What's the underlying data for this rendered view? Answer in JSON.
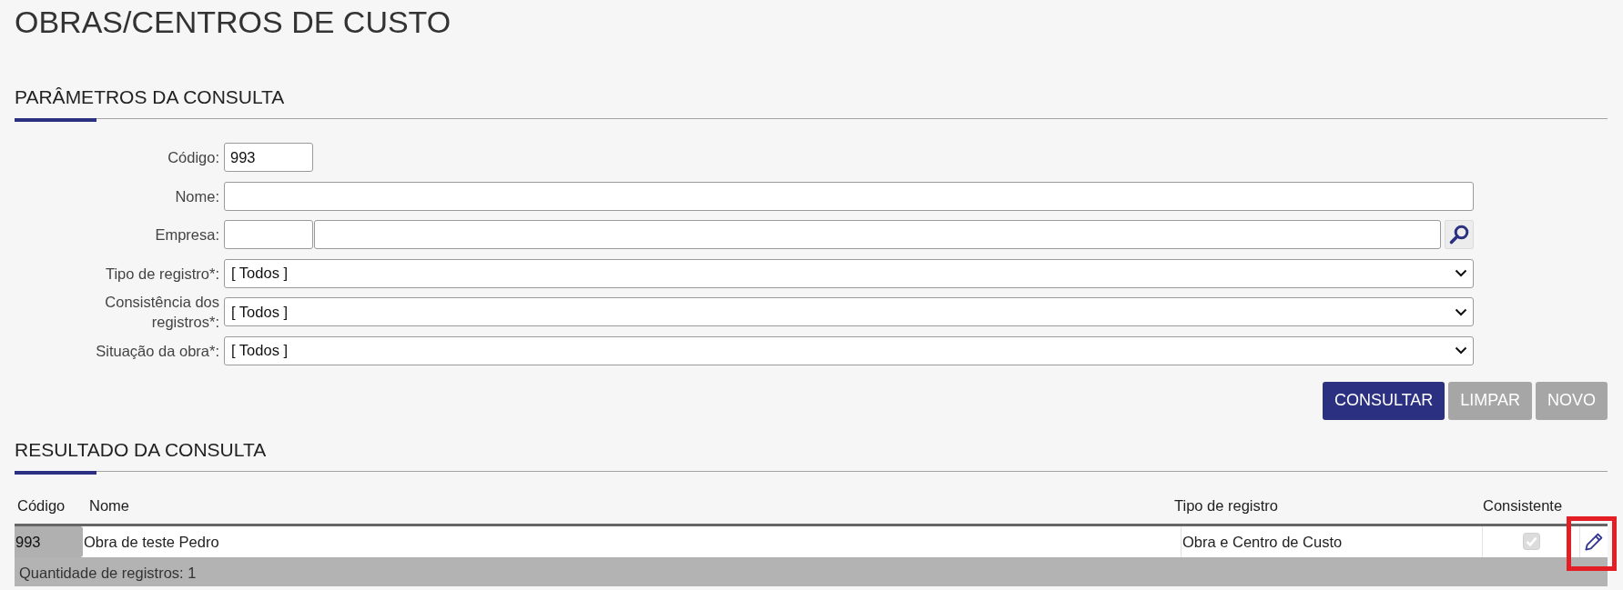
{
  "page": {
    "title": "OBRAS/CENTROS DE CUSTO"
  },
  "query": {
    "heading": "PARÂMETROS DA CONSULTA",
    "fields": [
      {
        "kind": "code",
        "label": "Código:",
        "value": "993"
      },
      {
        "kind": "text",
        "label": "Nome:"
      },
      {
        "kind": "lookup",
        "label": "Empresa:"
      },
      {
        "kind": "select",
        "label": "Tipo de registro*:",
        "value": "[ Todos ]"
      },
      {
        "kind": "select",
        "label": "Consistência dos registros*:",
        "value": "[ Todos ]"
      },
      {
        "kind": "select",
        "label": "Situação da obra*:",
        "value": "[ Todos ]"
      }
    ],
    "buttons": [
      {
        "label": "CONSULTAR",
        "kind": "primary"
      },
      {
        "label": "LIMPAR",
        "kind": "secondary"
      },
      {
        "label": "NOVO",
        "kind": "secondary"
      }
    ]
  },
  "results": {
    "heading": "RESULTADO DA CONSULTA",
    "table": {
      "columns": [
        "Código",
        "Nome",
        "Tipo de registro",
        "Consistente"
      ],
      "rows": [
        {
          "cells": [
            "993",
            "Obra de teste Pedro",
            "Obra e Centro de Custo"
          ],
          "consistent": {
            "checked": true,
            "disabled": true
          },
          "edit_highlighted": true
        }
      ]
    },
    "footer": "Quantidade de registros: 1"
  }
}
